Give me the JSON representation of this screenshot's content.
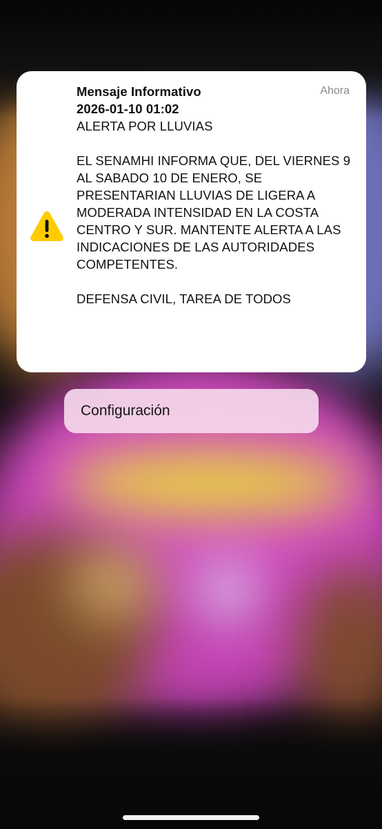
{
  "alert": {
    "title": "Mensaje Informativo",
    "datetime": "2026-01-10 01:02",
    "subject": "ALERTA POR LLUVIAS",
    "body": "EL SENAMHI INFORMA QUE, DEL VIERNES 9 AL SABADO 10 DE ENERO, SE PRESENTARIAN LLUVIAS DE LIGERA A MODERADA INTENSIDAD EN LA COSTA CENTRO Y SUR. MANTENTE ALERTA A LAS INDICACIONES DE LAS AUTORIDADES COMPETENTES.",
    "footer": "DEFENSA CIVIL, TAREA DE TODOS",
    "time": "Ahora",
    "icon": "warning-icon",
    "icon_color": "#FFCC00"
  },
  "actions": {
    "settings_label": "Configuración"
  }
}
